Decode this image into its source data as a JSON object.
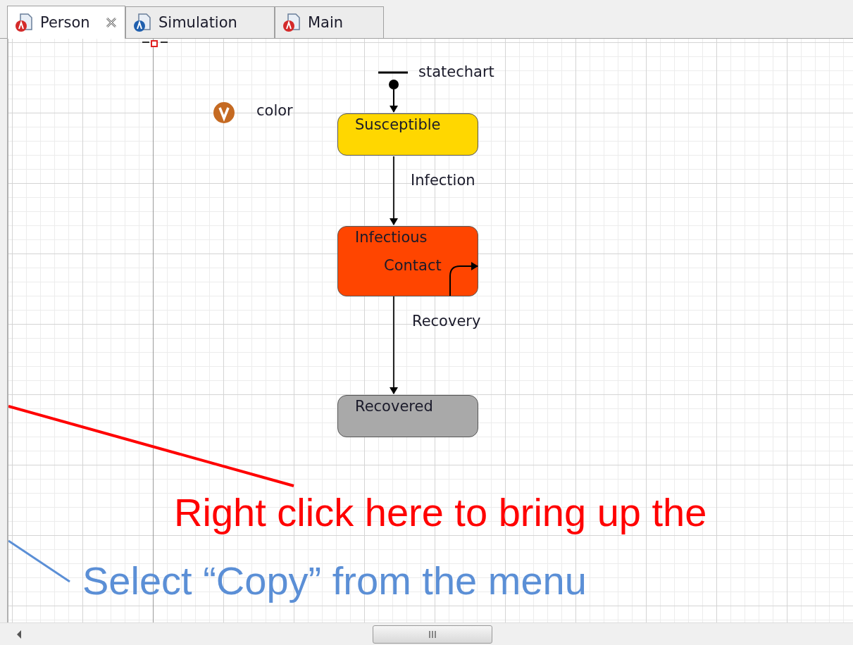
{
  "tabs": [
    {
      "label": "Person",
      "selected": true,
      "closable": true,
      "color": "#d42a2a"
    },
    {
      "label": "Simulation",
      "selected": false,
      "closable": false,
      "color": "#1f5fae"
    },
    {
      "label": "Main",
      "selected": false,
      "closable": false,
      "color": "#d42a2a"
    }
  ],
  "canvas": {
    "statechart": {
      "label": "statechart"
    },
    "variable": {
      "label": "color"
    },
    "states": [
      {
        "name": "Susceptible",
        "color": "#ffd700"
      },
      {
        "name": "Infectious",
        "color": "#ff4500",
        "internal_transition": "Contact"
      },
      {
        "name": "Recovered",
        "color": "#a9a9a9"
      }
    ],
    "transitions": [
      {
        "label": "Infection"
      },
      {
        "label": "Recovery"
      }
    ]
  },
  "annotations": [
    {
      "text": "Right click here to bring up the",
      "color": "#ff0000"
    },
    {
      "text": "Select “Copy” from the menu",
      "color": "#5b8fd6"
    }
  ]
}
